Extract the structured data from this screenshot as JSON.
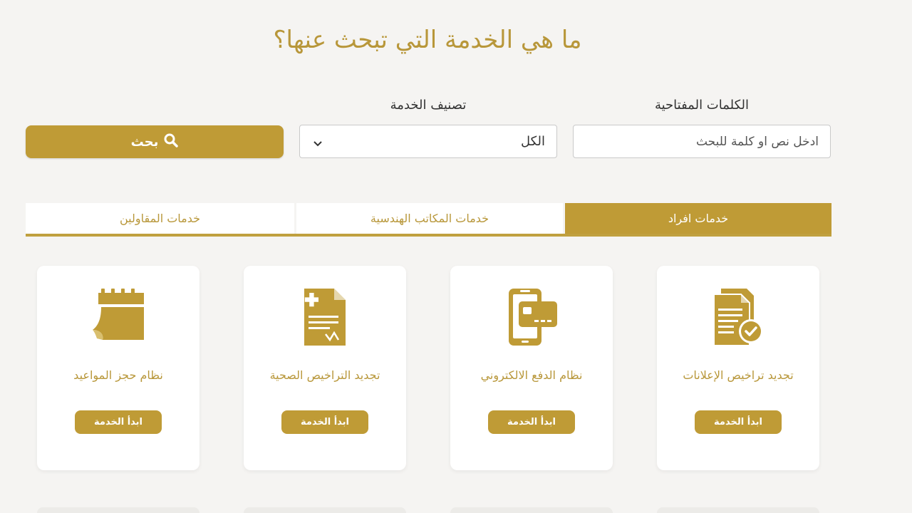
{
  "heading": "ما هي الخدمة التي تبحث عنها؟",
  "search": {
    "keywords_label": "الكلمات المفتاحية",
    "keywords_placeholder": "ادخل نص او كلمة للبحث",
    "category_label": "تصنيف الخدمة",
    "category_value": "الكل",
    "button_label": "بحث"
  },
  "tabs": [
    {
      "label": "خدمات المقاولين"
    },
    {
      "label": "خدمات المكاتب الهندسية"
    },
    {
      "label": "خدمات افراد"
    }
  ],
  "services": [
    {
      "name": "نظام حجز المواعيد",
      "action": "ابدأ الخدمة",
      "icon": "calendar-icon"
    },
    {
      "name": "تجديد التراخيص الصحية",
      "action": "ابدأ الخدمة",
      "icon": "medical-document-icon"
    },
    {
      "name": "نظام الدفع الالكتروني",
      "action": "ابدأ الخدمة",
      "icon": "mobile-payment-icon"
    },
    {
      "name": "تجديد تراخيص الإعلانات",
      "action": "ابدأ الخدمة",
      "icon": "approved-document-icon"
    }
  ],
  "colors": {
    "accent": "#bf9b36",
    "background": "#f5f4f2",
    "card": "#ffffff"
  }
}
